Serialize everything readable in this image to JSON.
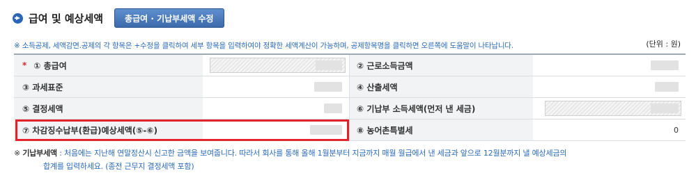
{
  "header": {
    "title": "급여 및 예상세액",
    "edit_button": "총급여 · 기납부세액 수정"
  },
  "notice": "※ 소득공제, 세액감면.공제의 각 항목은 +수정을 클릭하여 세부 항목을 입력하여야 정확한 세액계산이 가능하며, 공제항목명을 클릭하면 오른쪽에 도움말이 나타납니다.",
  "unit": "(단위 : 원)",
  "rows": [
    {
      "left_label": "① 총급여",
      "left_required": "*",
      "right_label": "② 근로소득금액",
      "right_value": ""
    },
    {
      "left_label": "③ 과세표준",
      "right_label": "④ 산출세액",
      "right_value": ""
    },
    {
      "left_label": "⑤ 결정세액",
      "right_label": "⑥ 기납부 소득세액(먼저 낸 세금)",
      "right_value": ""
    },
    {
      "left_label": "⑦ 차감징수납부(환급)예상세액(⑤-⑥)",
      "right_label": "⑧ 농어촌특별세",
      "right_value": "0"
    }
  ],
  "footnote": {
    "prefix": "※ ",
    "term": "기납부세액",
    "line1": " : 처음에는 지난해 연말정산시 신고한 금액을 보여줍니다. 따라서 회사를 통해 올해 1월분부터 지금까지 매월 월급에서 낸 세금과 앞으로 12월분까지 낼 예상세금의",
    "line2": "합계를 입력하세요. (종전 근무지 결정세액 포함)"
  },
  "colors": {
    "accent": "#2b6ab7",
    "highlight_border": "#e2232a"
  },
  "icons": {
    "header": "arrow-circle-icon"
  }
}
